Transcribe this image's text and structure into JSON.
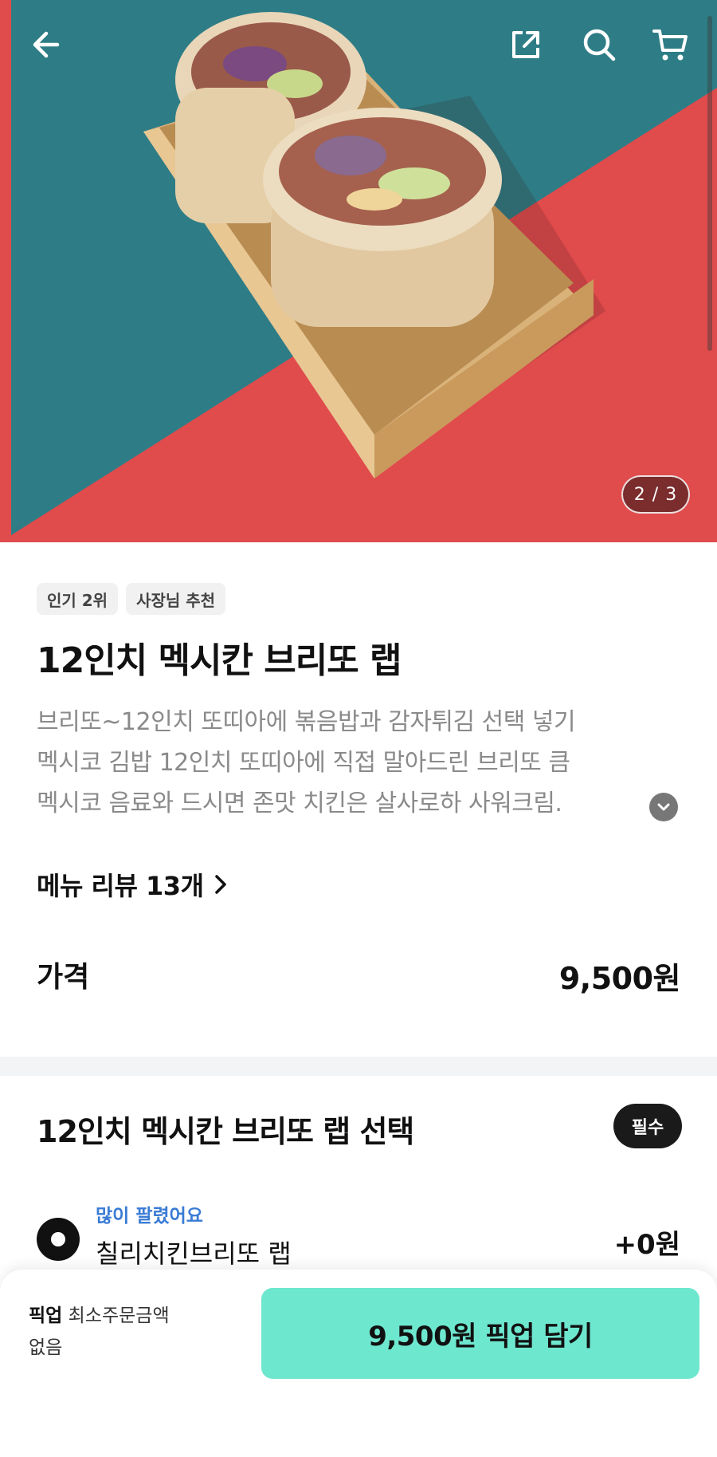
{
  "hero": {
    "image_counter": "2 / 3",
    "icons": [
      "back-arrow-icon",
      "share-icon",
      "search-icon",
      "cart-icon"
    ],
    "colors": {
      "teal": "#2e7d86",
      "red": "#e04b4c"
    }
  },
  "menu": {
    "badges": [
      "인기 2위",
      "사장님 추천"
    ],
    "title": "12인치 멕시칸 브리또 랩",
    "description_lines": [
      "브리또~12인치 또띠아에 볶음밥과 감자튀김 선택 넣기",
      "멕시코 김밥 12인치 또띠아에 직접 말아드린 브리또 큼",
      "멕시코 음료와 드시면 존맛 치킨은 살사로하 사워크림."
    ],
    "review_link": "메뉴 리뷰 13개",
    "price_label": "가격",
    "price_value": "9,500원"
  },
  "option_group": {
    "title": "12인치 멕시칸 브리또 랩 선택",
    "required_label": "필수",
    "options": [
      {
        "tag": "많이 팔렸어요",
        "name": "칠리치킨브리또 랩",
        "price": "+0원",
        "selected": true
      }
    ]
  },
  "bottom_bar": {
    "pickup_bold": "픽업",
    "pickup_text": "최소주문금액",
    "pickup_text2": "없음",
    "cta_label": "9,500원 픽업 담기",
    "cta_color": "#6ee7cf"
  }
}
